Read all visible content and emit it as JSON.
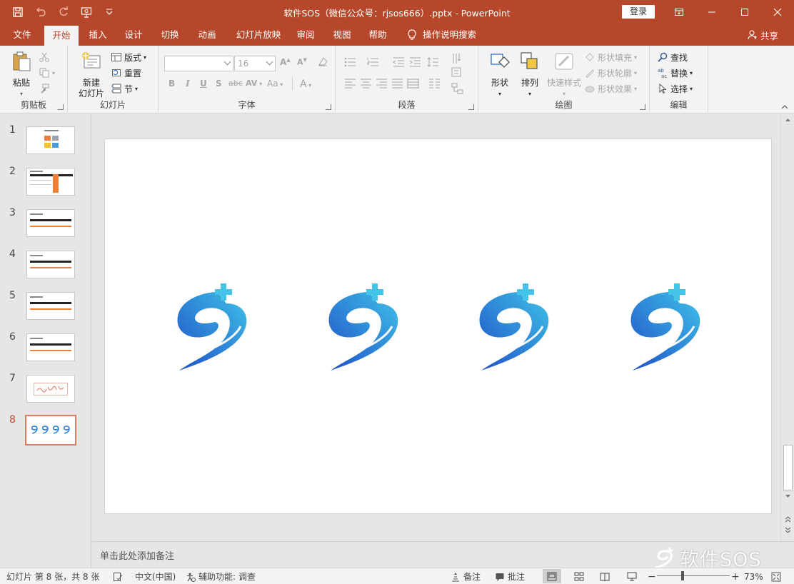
{
  "window": {
    "title": "软件SOS（微信公众号：rjsos666）.pptx  -  PowerPoint",
    "login_label": "登录"
  },
  "tabs": [
    "文件",
    "开始",
    "插入",
    "设计",
    "切换",
    "动画",
    "幻灯片放映",
    "审阅",
    "视图",
    "帮助"
  ],
  "active_tab": "开始",
  "tell_me": "操作说明搜索",
  "share_label": "共享",
  "ribbon": {
    "clipboard": {
      "label": "剪贴板",
      "paste": "粘贴"
    },
    "slides": {
      "label": "幻灯片",
      "new_slide_line1": "新建",
      "new_slide_line2": "幻灯片",
      "layout": "版式",
      "reset": "重置",
      "section": "节"
    },
    "font": {
      "label": "字体",
      "font_name": "",
      "font_size": "16",
      "bold": "B",
      "italic": "I",
      "underline": "U",
      "shadow": "S",
      "strike": "abc",
      "spacing": "AV",
      "case": "Aa"
    },
    "paragraph": {
      "label": "段落"
    },
    "drawing": {
      "label": "绘图",
      "shapes": "形状",
      "arrange": "排列",
      "quick_styles": "快速样式",
      "shape_fill": "形状填充",
      "shape_outline": "形状轮廓",
      "shape_effects": "形状效果"
    },
    "editing": {
      "label": "编辑",
      "find": "查找",
      "replace": "替换",
      "select": "选择"
    }
  },
  "thumbnails": {
    "numbers": [
      "1",
      "2",
      "3",
      "4",
      "5",
      "6",
      "7",
      "8"
    ],
    "active_index": 8
  },
  "notes_placeholder": "单击此处添加备注",
  "watermark": "软件SOS",
  "statusbar": {
    "slide_info": "幻灯片 第 8 张，共 8 张",
    "language": "中文(中国)",
    "accessibility": "辅助功能: 调查",
    "notes": "备注",
    "comments": "批注",
    "zoom": "73%"
  },
  "colors": {
    "accent": "#b7472a",
    "ribbon_bg": "#f3f3f3",
    "logo_dark": "#1f4fc7",
    "logo_light": "#3fc2e8"
  }
}
